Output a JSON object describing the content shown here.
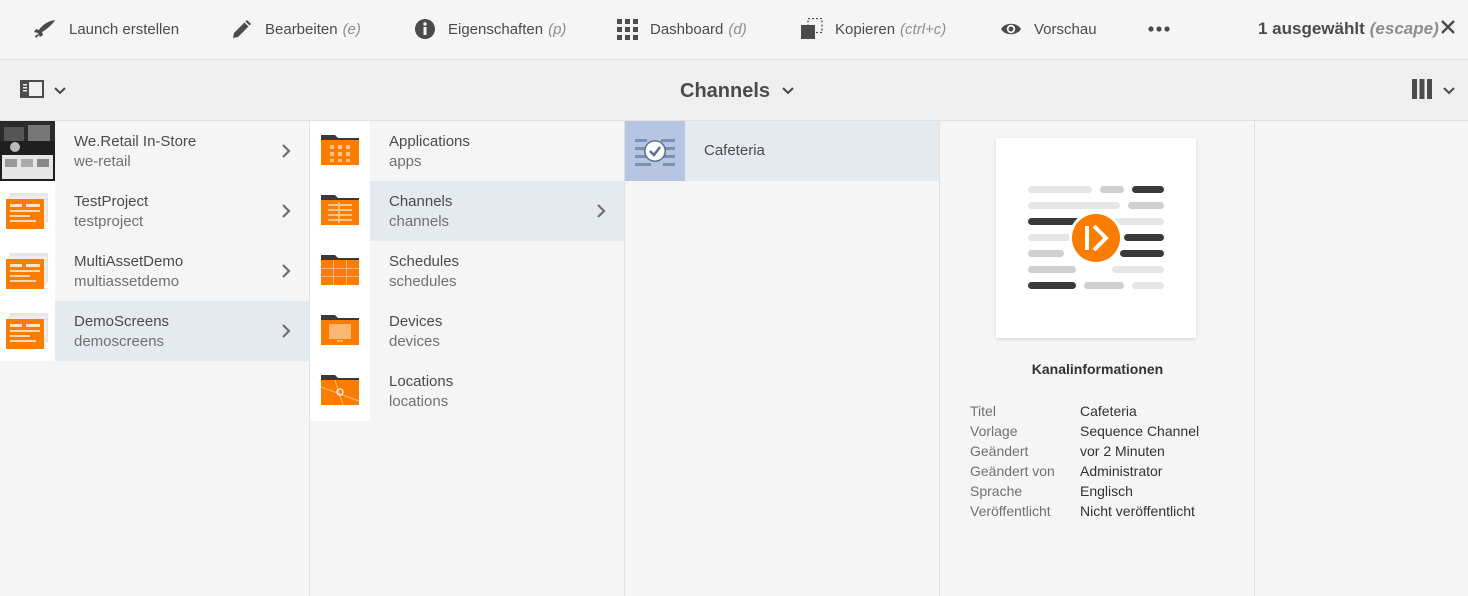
{
  "actionbar": {
    "items": [
      {
        "label": "Launch erstellen",
        "hint": "",
        "icon": "rocket-icon"
      },
      {
        "label": "Bearbeiten",
        "hint": "(e)",
        "icon": "pencil-icon"
      },
      {
        "label": "Eigenschaften",
        "hint": "(p)",
        "icon": "info-icon"
      },
      {
        "label": "Dashboard",
        "hint": "(d)",
        "icon": "grid-icon"
      },
      {
        "label": "Kopieren",
        "hint": "(ctrl+c)",
        "icon": "copy-icon"
      },
      {
        "label": "Vorschau",
        "hint": "",
        "icon": "eye-icon"
      }
    ],
    "more_icon": "more-icon",
    "selection": {
      "label": "1 ausgewählt",
      "hint": "(escape)"
    },
    "close_icon": "close-icon"
  },
  "titlebar": {
    "title": "Channels",
    "rail_icon": "rail-toggle-icon",
    "view_icon": "column-view-icon"
  },
  "columns": {
    "projects": [
      {
        "title": "We.Retail In-Store",
        "sub": "we-retail"
      },
      {
        "title": "TestProject",
        "sub": "testproject"
      },
      {
        "title": "MultiAssetDemo",
        "sub": "multiassetdemo"
      },
      {
        "title": "DemoScreens",
        "sub": "demoscreens"
      }
    ],
    "folders": [
      {
        "title": "Applications",
        "sub": "apps"
      },
      {
        "title": "Channels",
        "sub": "channels"
      },
      {
        "title": "Schedules",
        "sub": "schedules"
      },
      {
        "title": "Devices",
        "sub": "devices"
      },
      {
        "title": "Locations",
        "sub": "locations"
      }
    ],
    "channels": [
      {
        "title": "Cafeteria"
      }
    ]
  },
  "preview": {
    "heading": "Kanalinformationen",
    "meta": [
      {
        "k": "Titel",
        "v": "Cafeteria"
      },
      {
        "k": "Vorlage",
        "v": "Sequence Channel"
      },
      {
        "k": "Geändert",
        "v": "vor 2 Minuten"
      },
      {
        "k": "Geändert von",
        "v": "Administrator"
      },
      {
        "k": "Sprache",
        "v": "Englisch"
      },
      {
        "k": "Veröffentlicht",
        "v": "Nicht veröffentlicht"
      }
    ]
  },
  "colors": {
    "accent_orange": "#fa7d00",
    "selected_row": "#e5e9f0",
    "selected_thumb": "#b6c6e2"
  }
}
